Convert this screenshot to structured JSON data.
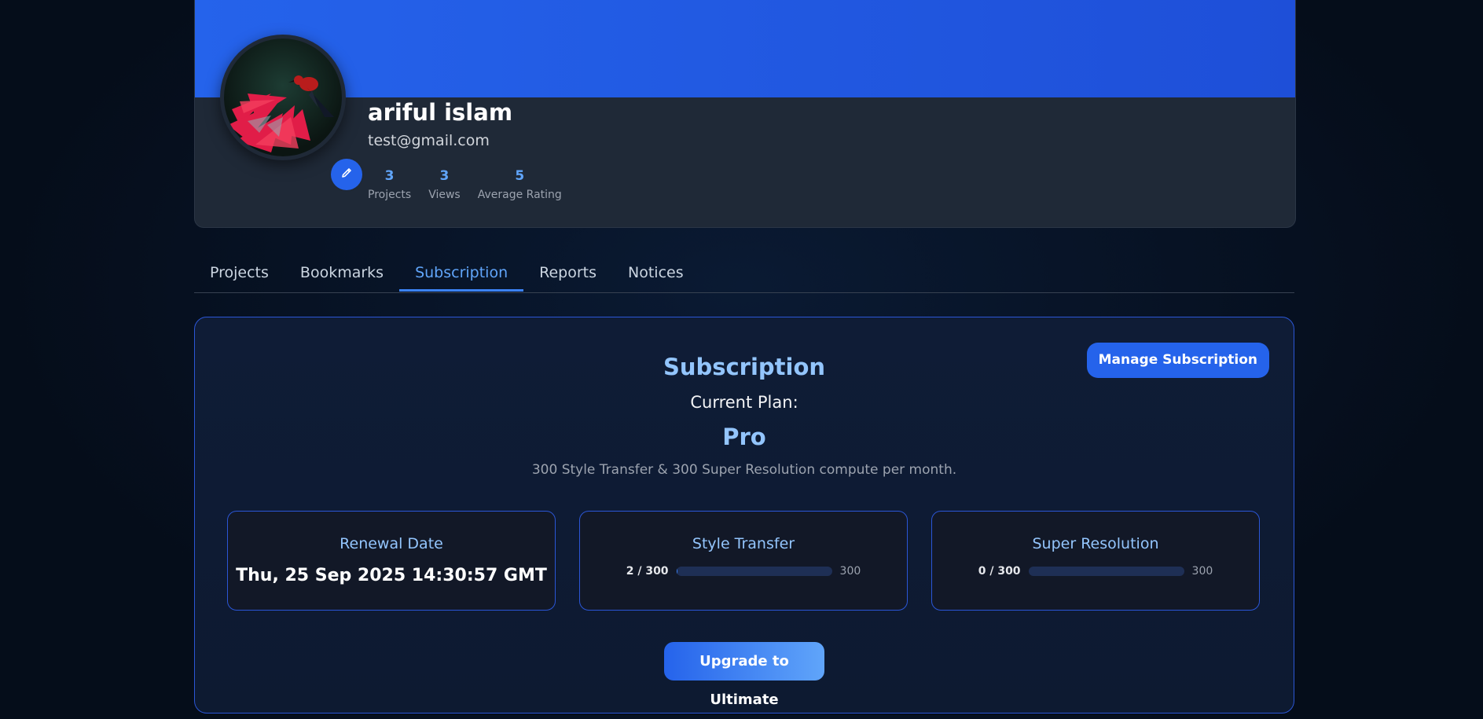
{
  "profile": {
    "name": "ariful islam",
    "email": "test@gmail.com",
    "stats": [
      {
        "value": "3",
        "label": "Projects"
      },
      {
        "value": "3",
        "label": "Views"
      },
      {
        "value": "5",
        "label": "Average Rating"
      }
    ],
    "avatar_icon": "bird-photo",
    "edit_icon": "pencil-icon"
  },
  "tabs": [
    {
      "label": "Projects"
    },
    {
      "label": "Bookmarks"
    },
    {
      "label": "Subscription",
      "active": true
    },
    {
      "label": "Reports"
    },
    {
      "label": "Notices"
    }
  ],
  "subscription": {
    "title": "Subscription",
    "manage_label": "Manage Subscription",
    "current_plan_label": "Current Plan:",
    "plan_name": "Pro",
    "plan_description": "300 Style Transfer & 300 Super Resolution compute per month.",
    "renewal": {
      "title": "Renewal Date",
      "date": "Thu, 25 Sep 2025 14:30:57 GMT"
    },
    "style_transfer": {
      "title": "Style Transfer",
      "usage": "2 / 300",
      "max": "300",
      "fraction": 0.0067
    },
    "super_resolution": {
      "title": "Super Resolution",
      "usage": "0 / 300",
      "max": "300",
      "fraction": 0
    },
    "upgrade_label": "Upgrade to Ultimate"
  },
  "colors": {
    "accent": "#2563eb",
    "accent_light": "#93c5fd",
    "background": "#06101f",
    "card": "#1f2937"
  }
}
